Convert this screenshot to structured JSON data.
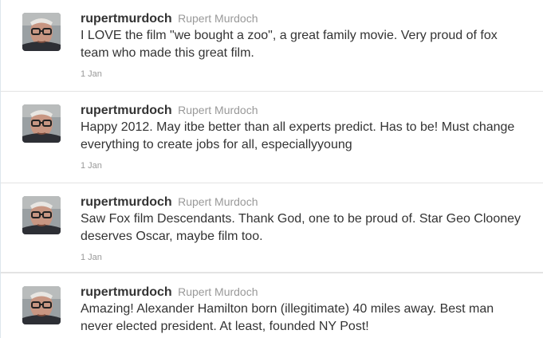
{
  "tweets": [
    {
      "screen_name": "rupertmurdoch",
      "full_name": "Rupert Murdoch",
      "text": "I LOVE the film \"we bought a zoo\", a great family movie. Very proud of fox team who made this great film.",
      "time": "1 Jan"
    },
    {
      "screen_name": "rupertmurdoch",
      "full_name": "Rupert Murdoch",
      "text": "Happy 2012. May itbe better than all experts predict. Has to be! Must change everything to create jobs for all, especiallyyoung",
      "time": "1 Jan"
    },
    {
      "screen_name": "rupertmurdoch",
      "full_name": "Rupert Murdoch",
      "text": "Saw Fox film Descendants. Thank God, one to be proud of. Star Geo Clooney deserves Oscar, maybe film too.",
      "time": "1 Jan"
    },
    {
      "screen_name": "rupertmurdoch",
      "full_name": "Rupert Murdoch",
      "text": "Amazing! Alexander Hamilton born (illegitimate) 40 miles away. Best man never elected president. At least, founded NY Post!",
      "time": ""
    }
  ],
  "colors": {
    "text": "#333333",
    "muted": "#999999",
    "divider": "#e3e3e3"
  }
}
